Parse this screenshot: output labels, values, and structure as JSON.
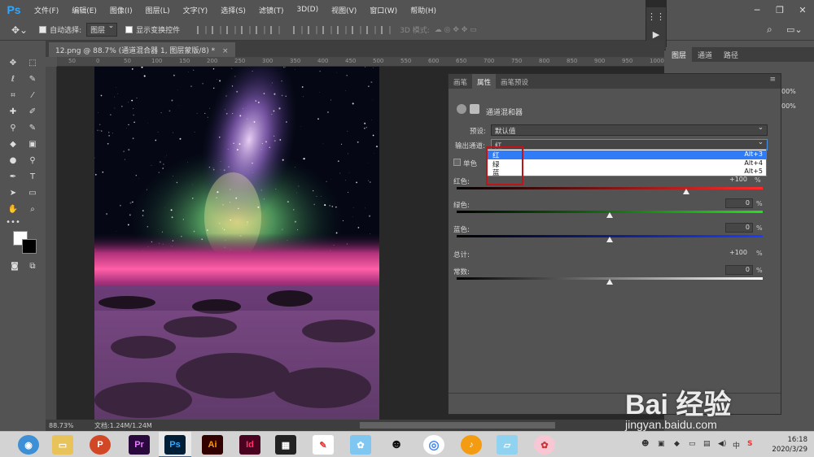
{
  "app": {
    "logo": "Ps",
    "menu": [
      "文件(F)",
      "编辑(E)",
      "图像(I)",
      "图层(L)",
      "文字(Y)",
      "选择(S)",
      "滤镜(T)",
      "3D(D)",
      "视图(V)",
      "窗口(W)",
      "帮助(H)"
    ]
  },
  "options": {
    "auto_select_label": "自动选择:",
    "auto_select_value": "图层",
    "show_transform_label": "显示变换控件",
    "mode_3d_label": "3D 模式:"
  },
  "document": {
    "tab_title": "12.png @ 88.7% (通道混合器 1, 图层蒙版/8) *",
    "ruler_ticks": [
      "50",
      "0",
      "50",
      "100",
      "150",
      "200",
      "250",
      "300",
      "350",
      "400",
      "450",
      "500",
      "550",
      "600",
      "650",
      "700",
      "750",
      "800",
      "850",
      "900",
      "950",
      "1000",
      "1050",
      "1100"
    ]
  },
  "status": {
    "zoom": "88.73%",
    "doc_info": "文档:1.24M/1.24M"
  },
  "right_dock": {
    "tabs": [
      "图层",
      "通道",
      "路径"
    ],
    "opacity_value": "00%",
    "fill_value": "00%"
  },
  "properties": {
    "tabs": [
      "画笔",
      "属性",
      "画笔预设"
    ],
    "active_tab": "属性",
    "title": "通道混和器",
    "preset_label": "预设:",
    "preset_value": "默认值",
    "output_label": "输出通道:",
    "output_value": "红",
    "mono_label": "单色",
    "channels": [
      {
        "label": "红色:",
        "value": "+100",
        "pct": "%"
      },
      {
        "label": "绿色:",
        "value": "0",
        "pct": "%"
      },
      {
        "label": "蓝色:",
        "value": "0",
        "pct": "%"
      }
    ],
    "total_label": "总计:",
    "total_value": "+100",
    "total_pct": "%",
    "constant_label": "常数:",
    "constant_value": "0",
    "constant_pct": "%",
    "slider_positions": {
      "red": 0.75,
      "green": 0.5,
      "blue": 0.5,
      "constant": 0.5
    }
  },
  "dropdown": {
    "items": [
      {
        "label": "红",
        "shortcut": "Alt+3"
      },
      {
        "label": "绿",
        "shortcut": "Alt+4"
      },
      {
        "label": "蓝",
        "shortcut": "Alt+5"
      }
    ]
  },
  "watermark": {
    "brand": "Bai 经验",
    "url": "jingyan.baidu.com"
  },
  "taskbar": {
    "apps": [
      "P",
      "Pr",
      "Ps",
      "Ai",
      "Id"
    ],
    "time": "16:18",
    "date": "2020/3/29"
  },
  "colors": {
    "ps_blue": "#31a8ff",
    "selection": "#2f7cf6",
    "highlight_box": "#c0141c"
  }
}
